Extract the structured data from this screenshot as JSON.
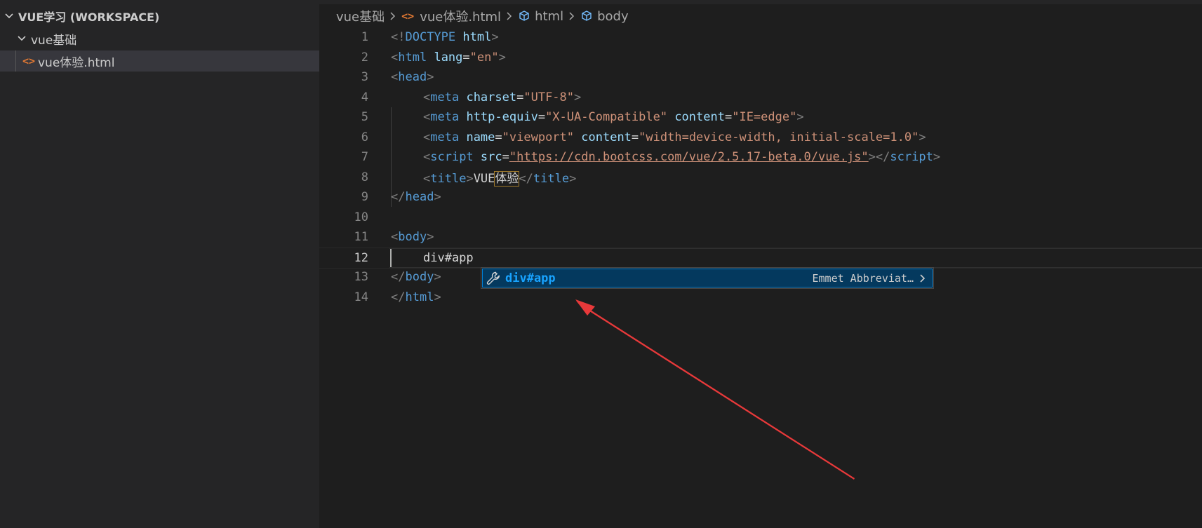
{
  "explorer": {
    "workspace_label": "VUE学习 (WORKSPACE)",
    "folder_label": "vue基础",
    "file_label": "vue体验.html",
    "file_icon_glyph": "<>"
  },
  "breadcrumb": {
    "folder": "vue基础",
    "file": "vue体验.html",
    "file_icon_glyph": "<>",
    "html_element": "html",
    "body_element": "body"
  },
  "editor": {
    "current_line": 12,
    "lines": [
      {
        "n": "1"
      },
      {
        "n": "2"
      },
      {
        "n": "3"
      },
      {
        "n": "4"
      },
      {
        "n": "5"
      },
      {
        "n": "6"
      },
      {
        "n": "7"
      },
      {
        "n": "8"
      },
      {
        "n": "9"
      },
      {
        "n": "10"
      },
      {
        "n": "11"
      },
      {
        "n": "12"
      },
      {
        "n": "13"
      },
      {
        "n": "14"
      }
    ],
    "tokens": {
      "doctype_open": "<!",
      "doctype_kw": "DOCTYPE",
      "space": " ",
      "doctype_html": "html",
      "gt": ">",
      "lt": "<",
      "lt_slash": "</",
      "html_tag": "html",
      "lang_attr": "lang",
      "eq": "=",
      "lang_val": "\"en\"",
      "head_tag": "head",
      "meta_tag": "meta",
      "charset_attr": "charset",
      "charset_val": "\"UTF-8\"",
      "httpequiv_attr": "http-equiv",
      "httpequiv_val": "\"X-UA-Compatible\"",
      "content_attr": "content",
      "content_val_ie": "\"IE=edge\"",
      "name_attr": "name",
      "name_val": "\"viewport\"",
      "content_val_vp": "\"width=device-width, initial-scale=1.0\"",
      "script_tag": "script",
      "src_attr": "src",
      "quote": "\"",
      "src_url": "https://cdn.bootcss.com/vue/2.5.17-beta.0/vue.js",
      "title_tag": "title",
      "title_text_a": "VUE",
      "title_text_b": "体验",
      "body_tag": "body",
      "typed_text": "div#app"
    }
  },
  "suggest": {
    "label": "div#app",
    "detail": "Emmet Abbreviat…",
    "icon": "wrench-icon"
  },
  "colors": {
    "tag": "#569cd6",
    "attr": "#9cdcfe",
    "string": "#ce9178",
    "punct": "#808080",
    "annotation_arrow": "#e8393a"
  }
}
